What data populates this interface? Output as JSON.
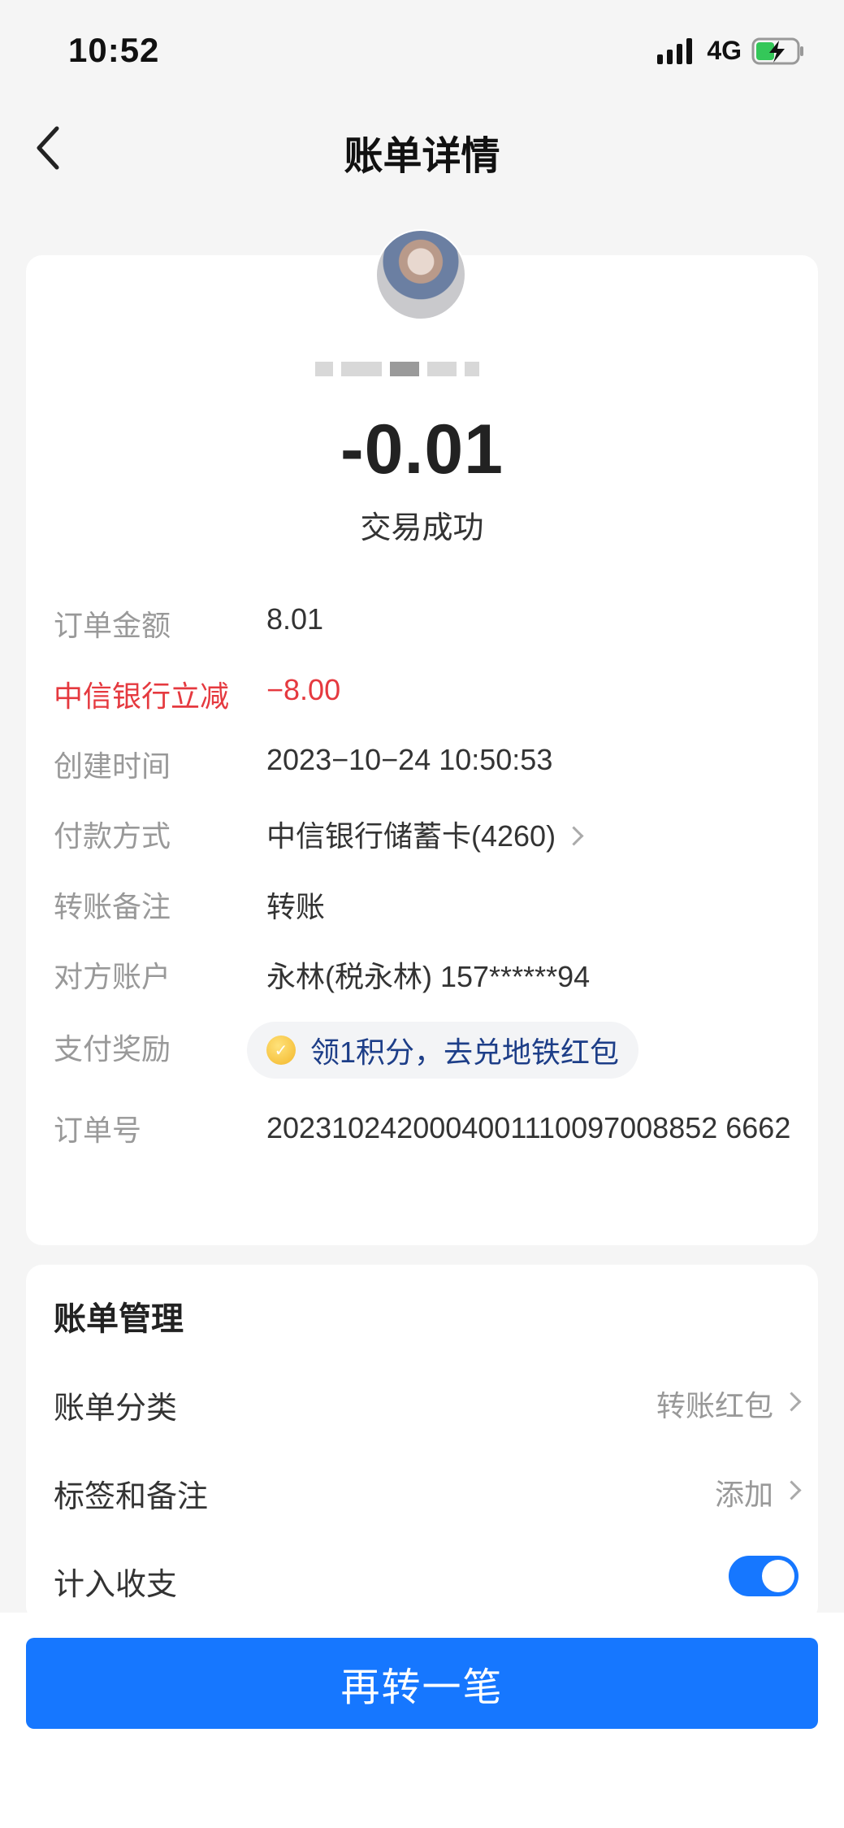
{
  "status_bar": {
    "time": "10:52",
    "network": "4G"
  },
  "nav": {
    "title": "账单详情"
  },
  "transaction": {
    "amount": "-0.01",
    "status": "交易成功"
  },
  "details": {
    "order_amount_label": "订单金额",
    "order_amount_value": "8.01",
    "discount_label": "中信银行立减",
    "discount_value": "−8.00",
    "created_label": "创建时间",
    "created_value": "2023−10−24 10:50:53",
    "payment_label": "付款方式",
    "payment_value": "中信银行储蓄卡(4260)",
    "remark_label": "转账备注",
    "remark_value": "转账",
    "counterparty_label": "对方账户",
    "counterparty_value": "永林(税永林) 157******94",
    "reward_label": "支付奖励",
    "reward_value": "领1积分，去兑地铁红包",
    "order_no_label": "订单号",
    "order_no_value": "2023102420004001110097008852 6662"
  },
  "management": {
    "title": "账单管理",
    "category_label": "账单分类",
    "category_value": "转账红包",
    "tags_label": "标签和备注",
    "tags_value": "添加",
    "include_label": "计入收支",
    "include_enabled": true
  },
  "actions": {
    "transfer_again": "再转一笔"
  },
  "colors": {
    "primary": "#1677ff",
    "discount_red": "#e5393f",
    "reward_text": "#1d3e88"
  }
}
